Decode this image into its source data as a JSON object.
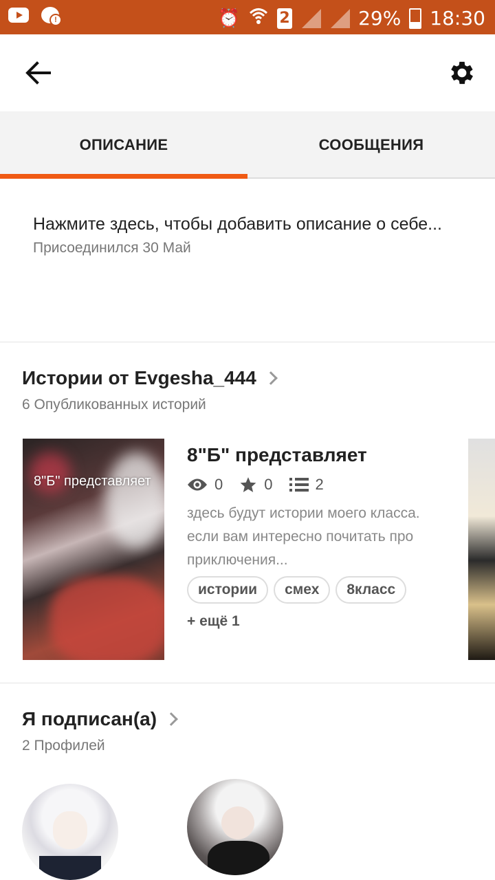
{
  "status_bar": {
    "battery": "29%",
    "time": "18:30",
    "sim_slot": "2",
    "icons": [
      "youtube-icon",
      "message-alert-icon",
      "alarm-icon",
      "wifi-icon",
      "sim-icon",
      "signal-icon",
      "signal-icon",
      "battery-icon"
    ]
  },
  "toolbar": {
    "back_icon": "arrow-left-icon",
    "settings_icon": "gear-icon"
  },
  "tabs": [
    {
      "label": "ОПИСАНИЕ",
      "active": true
    },
    {
      "label": "СООБЩЕНИЯ",
      "active": false
    }
  ],
  "description": {
    "prompt": "Нажмите здесь, чтобы добавить описание о себе...",
    "joined": "Присоединился 30 Май"
  },
  "stories_section": {
    "title": "Истории от Evgesha_444",
    "subtitle": "6 Опубликованных историй",
    "story": {
      "cover_text": "8\"Б\" представляет",
      "title": "8\"Б\" представляет",
      "views": "0",
      "votes": "0",
      "parts": "2",
      "description": "здесь будут истории моего класса. если вам интересно почитать про приключения...",
      "tags": [
        "истории",
        "смех",
        "8класс"
      ],
      "more_tags": "+ ещё 1"
    }
  },
  "following_section": {
    "title": "Я подписан(а)",
    "subtitle": "2 Профилей"
  },
  "colors": {
    "status_bar": "#c4501a",
    "accent": "#f05a14",
    "tab_bg": "#f3f3f3"
  }
}
